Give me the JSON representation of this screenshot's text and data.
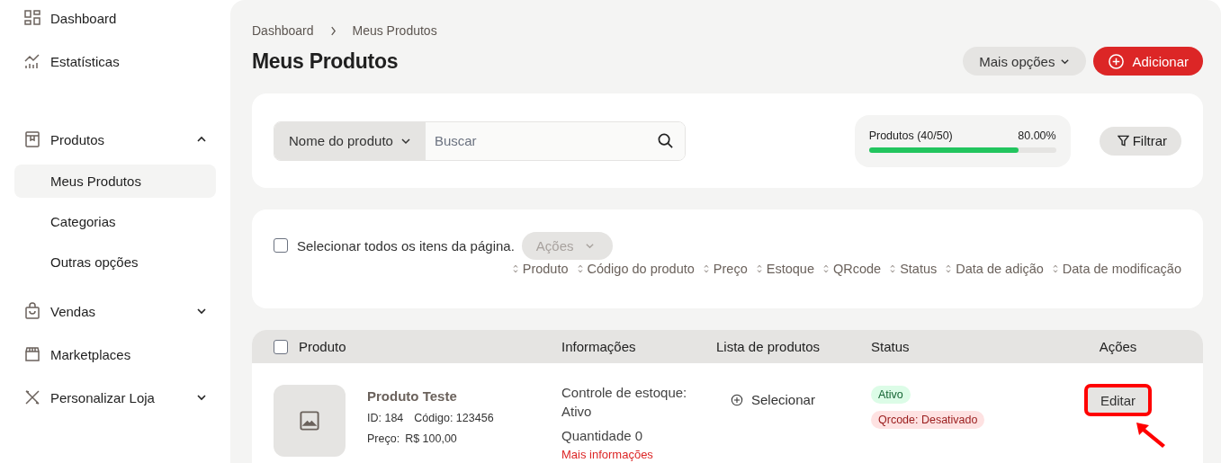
{
  "sidebar": {
    "groups": [
      {
        "items": [
          {
            "label": "Dashboard",
            "selected": false
          },
          {
            "label": "Estatísticas",
            "selected": false
          }
        ]
      },
      {
        "items": [
          {
            "label": "Produtos",
            "selected": false,
            "expanded": true,
            "children": [
              {
                "label": "Meus Produtos",
                "selected": true
              },
              {
                "label": "Categorias",
                "selected": false
              },
              {
                "label": "Outras opções",
                "selected": false
              }
            ]
          },
          {
            "label": "Vendas",
            "selected": false,
            "expanded": false
          },
          {
            "label": "Marketplaces",
            "selected": false
          },
          {
            "label": "Personalizar Loja",
            "selected": false,
            "expanded": false
          }
        ]
      }
    ]
  },
  "breadcrumb": [
    "Dashboard",
    "Meus Produtos"
  ],
  "title": "Meus Produtos",
  "header_buttons": {
    "more": "Mais opções",
    "add": "Adicionar"
  },
  "search": {
    "field_select": "Nome do produto",
    "placeholder": "Buscar"
  },
  "quota": {
    "label": "Produtos (40/50)",
    "percent": "80.00%",
    "level": 0.8
  },
  "filter_button": "Filtrar",
  "bulk": {
    "select_all": {
      "label": "Selecionar todos os itens da página.",
      "checked": false
    },
    "actions": {
      "label": "Ações",
      "disabled": true
    }
  },
  "sort_options": [
    "Produto",
    "Código do produto",
    "Preço",
    "Estoque",
    "QRcode",
    "Status",
    "Data de adição",
    "Data de modificação"
  ],
  "table": {
    "select_all_checked": false,
    "columns": [
      "Produto",
      "Informações",
      "Lista de produtos",
      "Status",
      "Ações"
    ],
    "rows": [
      {
        "name": "Produto Teste",
        "id": "ID: 184",
        "code": "Código: 123456",
        "price_label": "Preço:",
        "price": "R$ 100,00",
        "info": [
          "Controle de estoque: Ativo",
          "Quantidade 0"
        ],
        "info_link": "Mais informações",
        "list_action": "Selecionar",
        "badges": [
          {
            "text": "Ativo",
            "color": "#dcfce7"
          },
          {
            "text": "Qrcode: Desativado",
            "color": "#fee2e2"
          }
        ],
        "action": "Editar",
        "highlighted": true
      }
    ]
  }
}
